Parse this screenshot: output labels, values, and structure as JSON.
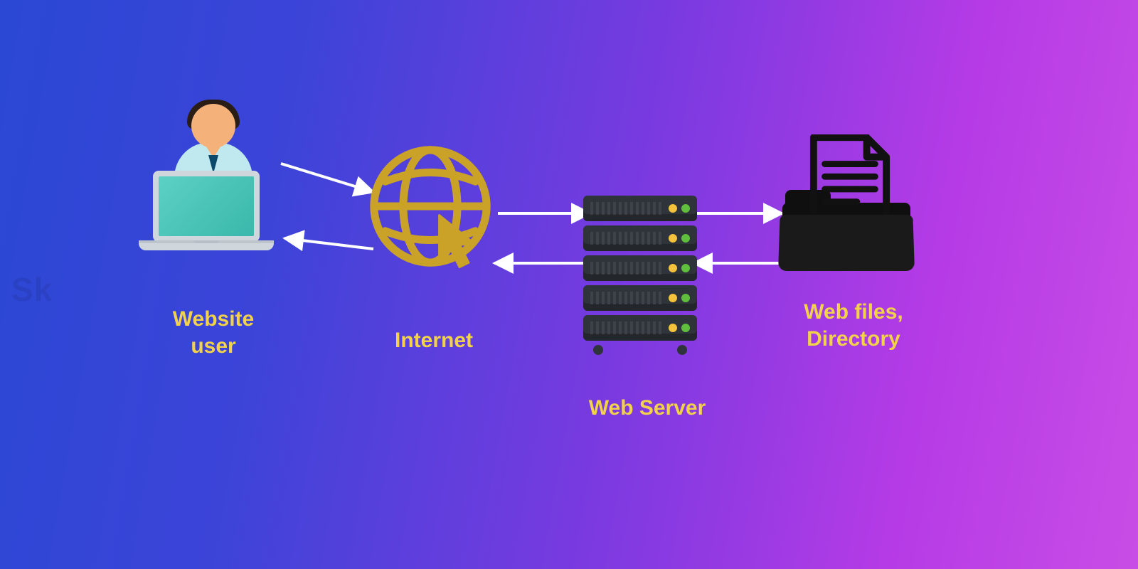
{
  "nodes": {
    "user": {
      "label": "Website\nuser",
      "icon": "user-laptop-icon"
    },
    "internet": {
      "label": "Internet",
      "icon": "globe-cursor-icon"
    },
    "server": {
      "label": "Web Server",
      "icon": "server-rack-icon"
    },
    "files": {
      "label": "Web files,\nDirectory",
      "icon": "folder-document-icon"
    }
  },
  "arrows": [
    {
      "from": "user",
      "to": "internet",
      "dir": "forward"
    },
    {
      "from": "internet",
      "to": "user",
      "dir": "back"
    },
    {
      "from": "internet",
      "to": "server",
      "dir": "forward"
    },
    {
      "from": "server",
      "to": "internet",
      "dir": "back"
    },
    {
      "from": "server",
      "to": "files",
      "dir": "forward"
    },
    {
      "from": "files",
      "to": "server",
      "dir": "back"
    }
  ],
  "colors": {
    "label": "#f2d24a",
    "arrow": "#ffffff",
    "globe": "#c9a227",
    "server_body": "#2f333a",
    "led_yellow": "#f4c23a",
    "led_green": "#5fbf3c",
    "bg_left": "#2a48d4",
    "bg_right": "#c84de6"
  },
  "watermark": "Sk"
}
